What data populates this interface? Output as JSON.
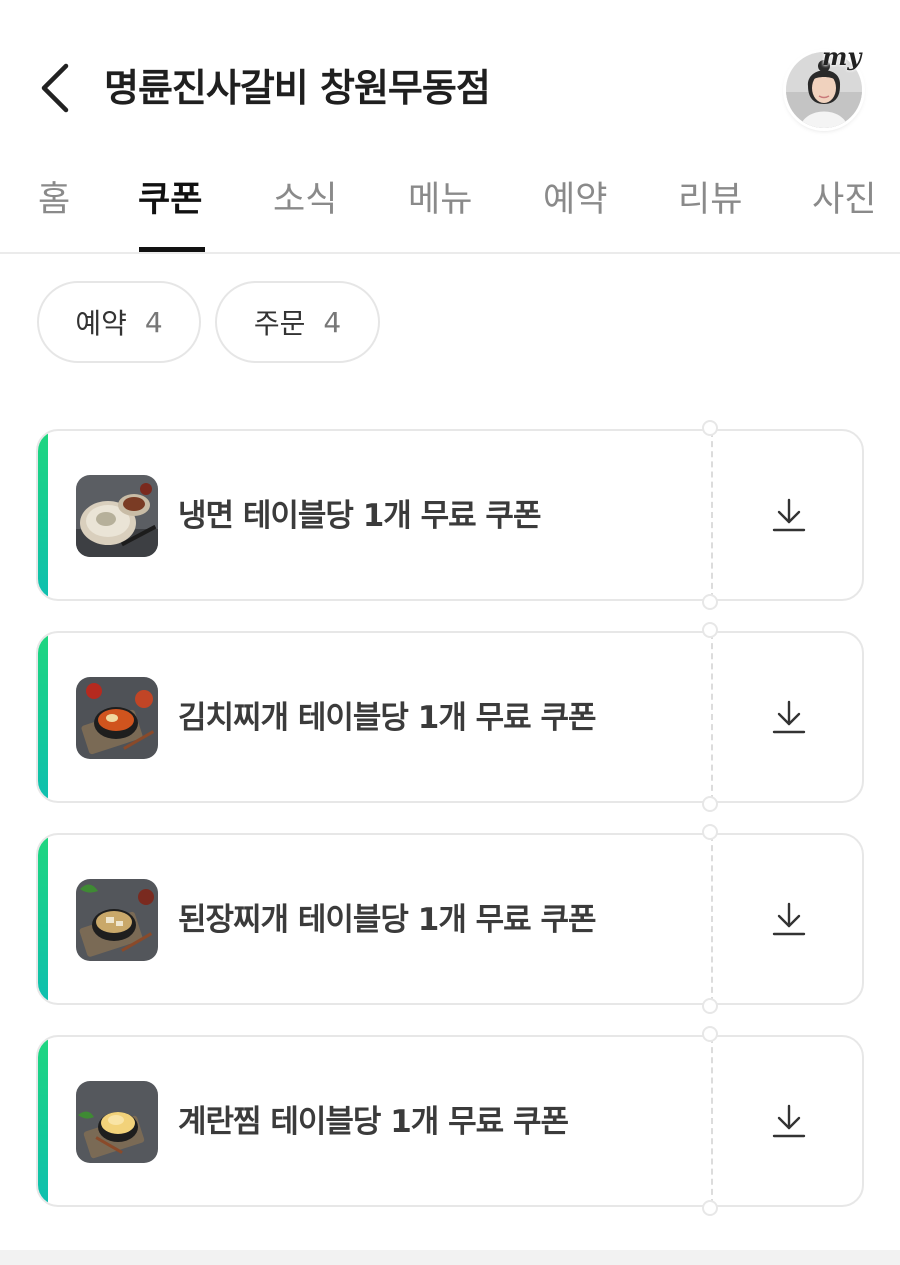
{
  "header": {
    "title": "명륜진사갈비 창원무동점",
    "my_badge": "my"
  },
  "tabs": [
    {
      "label": "홈",
      "active": false
    },
    {
      "label": "쿠폰",
      "active": true
    },
    {
      "label": "소식",
      "active": false
    },
    {
      "label": "메뉴",
      "active": false
    },
    {
      "label": "예약",
      "active": false
    },
    {
      "label": "리뷰",
      "active": false
    },
    {
      "label": "사진",
      "active": false
    }
  ],
  "filters": [
    {
      "label": "예약",
      "count": "4"
    },
    {
      "label": "주문",
      "count": "4"
    }
  ],
  "coupons": [
    {
      "label": "냉면 테이블당 1개 무료 쿠폰",
      "image": "naengmyeon-photo",
      "icon": "download-icon"
    },
    {
      "label": "김치찌개 테이블당 1개 무료 쿠폰",
      "image": "kimchi-jjigae-photo",
      "icon": "download-icon"
    },
    {
      "label": "된장찌개 테이블당 1개 무료 쿠폰",
      "image": "doenjang-jjigae-photo",
      "icon": "download-icon"
    },
    {
      "label": "계란찜 테이블당 1개 무료 쿠폰",
      "image": "gyeran-jjim-photo",
      "icon": "download-icon"
    }
  ],
  "colors": {
    "accent": "#1fd67f",
    "active_tab": "#111111",
    "inactive_tab": "#8a8a8a"
  }
}
